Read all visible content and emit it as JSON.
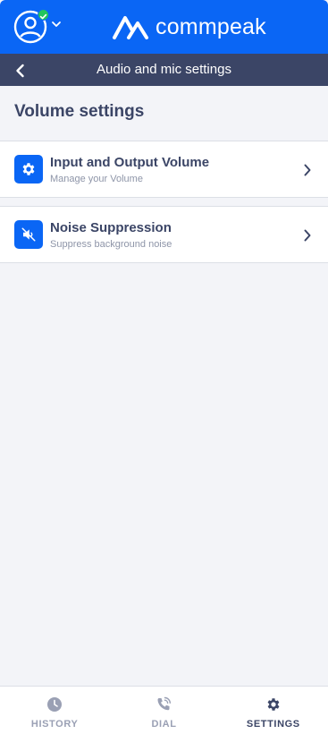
{
  "header": {
    "brand_name": "commpeak"
  },
  "subheader": {
    "title": "Audio and mic settings"
  },
  "section": {
    "title": "Volume settings"
  },
  "settings_items": [
    {
      "title": "Input and Output Volume",
      "subtitle": "Manage your Volume",
      "icon": "gear-icon"
    },
    {
      "title": "Noise Suppression",
      "subtitle": "Suppress background noise",
      "icon": "speaker-muted-icon"
    }
  ],
  "bottom_nav": {
    "tabs": [
      {
        "label": "HISTORY",
        "icon": "clock-icon",
        "active": false
      },
      {
        "label": "DIAL",
        "icon": "phone-icon",
        "active": false
      },
      {
        "label": "SETTINGS",
        "icon": "gear-icon",
        "active": true
      }
    ]
  },
  "colors": {
    "primary": "#0a66f5",
    "header_dark": "#3b4566",
    "background": "#f3f4f8",
    "status_online": "#22c55e",
    "inactive_nav": "#9aa0b4"
  }
}
